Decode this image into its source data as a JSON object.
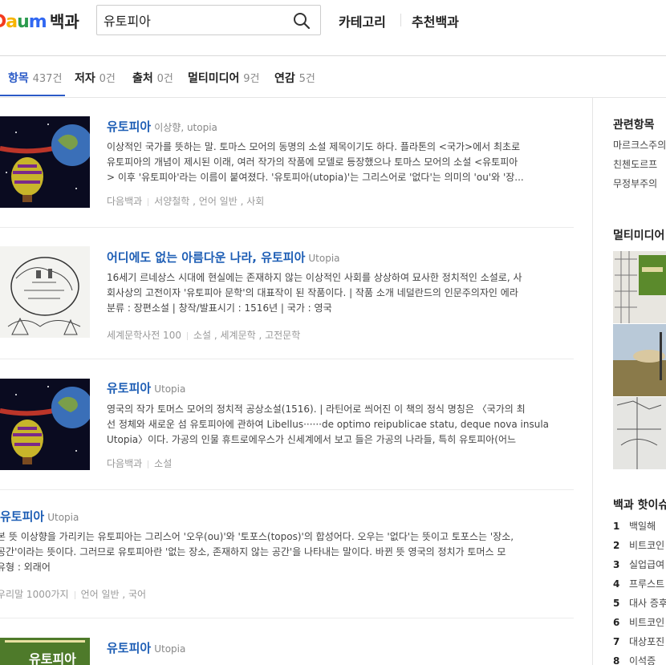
{
  "header": {
    "logo_text": "Daum",
    "logo_sub": "백과",
    "search_value": "유토피아",
    "gnb": [
      "카테고리",
      "추천백과"
    ]
  },
  "tabs": [
    {
      "label": "항목",
      "count": "437건"
    },
    {
      "label": "저자",
      "count": "0건"
    },
    {
      "label": "출처",
      "count": "0건"
    },
    {
      "label": "멀티미디어",
      "count": "9건"
    },
    {
      "label": "연감",
      "count": "5건"
    }
  ],
  "results": [
    {
      "title": "유토피아",
      "subtitle": "이상향, utopia",
      "lines": [
        "이상적인 국가를 뜻하는 말. 토마스 모어의 동명의 소설 제목이기도 하다. 플라톤의 <국가>에서 최초로",
        "유토피아의 개념이 제시된 이래, 여러 작가의 작품에 모델로 등장했으나 토마스 모어의 소설 <유토피아",
        "> 이후 '유토피아'라는 이름이 붙여졌다. '유토피아(utopia)'는 그리스어로 '없다'는 의미의 'ou'와 '장..."
      ],
      "meta": [
        "다음백과",
        "서양철학 , 언어 일반 , 사회"
      ]
    },
    {
      "title": "어디에도 없는 아름다운 나라, 유토피아",
      "subtitle": "Utopia",
      "lines": [
        "16세기 르네상스 시대에 현실에는 존재하지 않는 이상적인 사회를 상상하여 묘사한 정치적인 소설로, 사",
        "회사상의 고전이자 '유토피아 문학'의 대표작이 된 작품이다. | 작품 소개 네덜란드의 인문주의자인 에라",
        "분류 : 장편소설  |  창작/발표시기 : 1516년  |  국가 : 영국"
      ],
      "meta": [
        "세계문학사전 100",
        "소설 , 세계문학 , 고전문학"
      ]
    },
    {
      "title": "유토피아",
      "subtitle": "Utopia",
      "lines": [
        "영국의 작가 토머스 모어의 정치적 공상소설(1516). | 라틴어로 씌어진 이 책의 정식 명칭은 〈국가의 최",
        "선 정체와 새로운 섬 유토피아에 관하여 Libellus······de optimo reipublicae statu, deque nova insula",
        "Utopia〉이다. 가공의 인물 휴트로에우스가 신세계에서 보고 들은 가공의 나라들, 특히 유토피아(어느"
      ],
      "meta": [
        "다음백과",
        "소설"
      ]
    },
    {
      "title": "유토피아",
      "subtitle": "Utopia",
      "lines": [
        "본 뜻 이상향을 가리키는 유토피아는 그리스어 '오우(ou)'와 '토포스(topos)'의 합성어다. 오우는 '없다'는 뜻이고 토포스는 '장소,",
        "공간'이라는 뜻이다. 그러므로 유토피아란 '없는 장소, 존재하지 않는 공간'을 나타내는 말이다. 바뀐 뜻 영국의 정치가 토머스 모",
        "유형 : 외래어"
      ],
      "meta": [
        "우리말 1000가지",
        "언어 일반 , 국어"
      ]
    },
    {
      "title": "유토피아",
      "subtitle": "Utopia",
      "thumb_text": "유토피아"
    }
  ],
  "sidebar": {
    "related_title": "관련항목",
    "related": [
      "마르크스주의",
      "친첸도르프",
      "무정부주의"
    ],
    "multimedia_title": "멀티미디어",
    "popular_title": "백과 핫이슈",
    "popular": [
      {
        "rank": "1",
        "label": "백일해"
      },
      {
        "rank": "2",
        "label": "비트코인"
      },
      {
        "rank": "3",
        "label": "실업급여"
      },
      {
        "rank": "4",
        "label": "프루스트"
      },
      {
        "rank": "5",
        "label": "대사 증후군"
      },
      {
        "rank": "6",
        "label": "비트코인"
      },
      {
        "rank": "7",
        "label": "대상포진"
      },
      {
        "rank": "8",
        "label": "이석증"
      }
    ]
  },
  "colors": {
    "link": "#1e5eb5",
    "tab_active": "#2b5bc7",
    "meta": "#999999"
  }
}
